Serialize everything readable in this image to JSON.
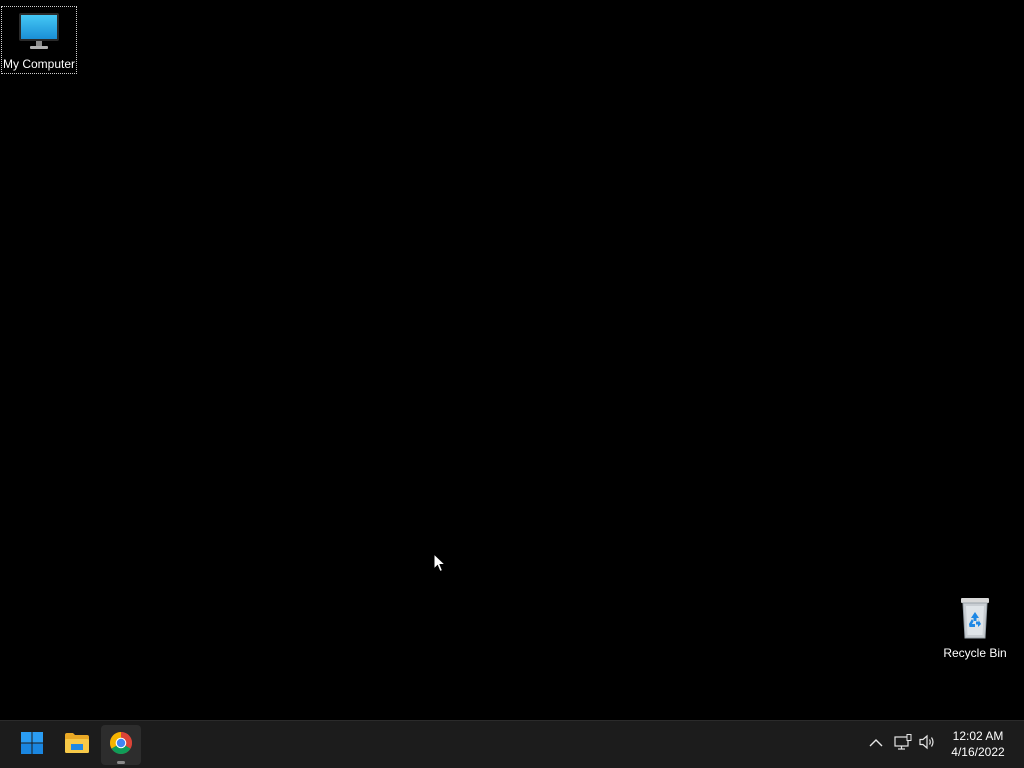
{
  "desktop": {
    "background_color": "#000000",
    "icons": [
      {
        "id": "my-computer",
        "label": "My Computer",
        "icon": "monitor-icon",
        "selected": true
      },
      {
        "id": "recycle-bin",
        "label": "Recycle Bin",
        "icon": "recycle-bin-icon",
        "selected": false
      }
    ]
  },
  "taskbar": {
    "background_color": "#1c1c1c",
    "pinned": [
      {
        "id": "start",
        "icon": "windows-logo-icon"
      },
      {
        "id": "file-explorer",
        "icon": "folder-icon"
      },
      {
        "id": "chrome",
        "icon": "chrome-icon",
        "active": true
      }
    ],
    "tray": {
      "icons": [
        "chevron-up-icon",
        "network-icon",
        "volume-icon"
      ],
      "time": "12:02 AM",
      "date": "4/16/2022"
    }
  },
  "colors": {
    "accent": "#0078d4",
    "folder": "#f2c14e"
  }
}
